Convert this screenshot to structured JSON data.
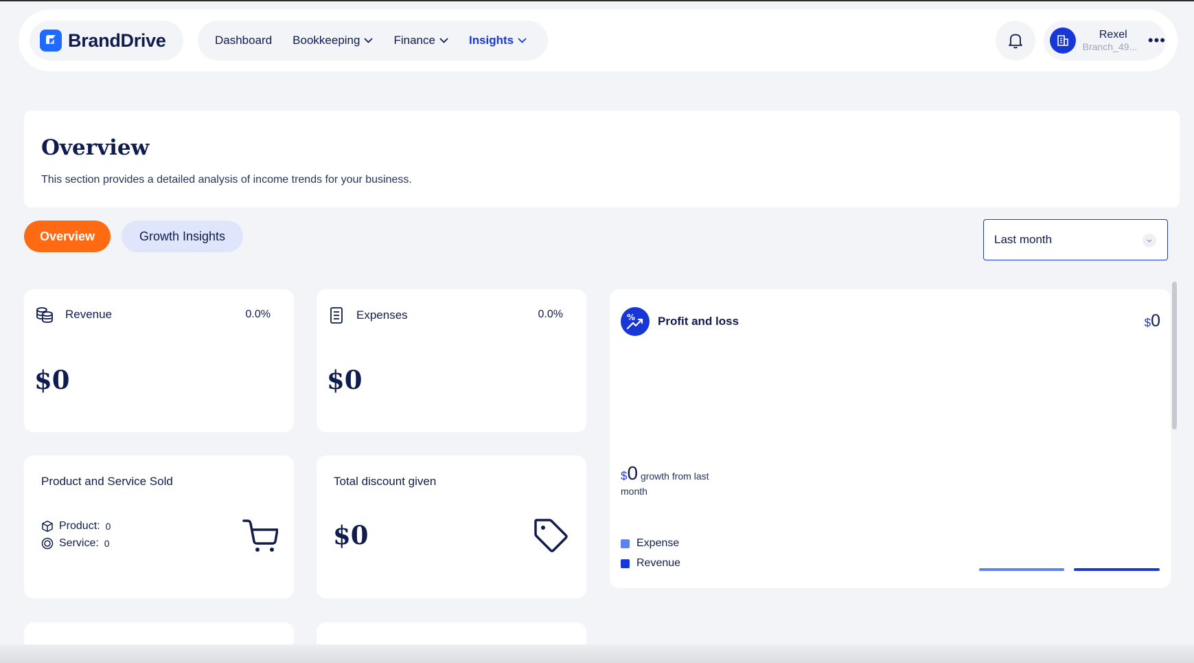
{
  "header": {
    "brand": "BrandDrive",
    "nav": [
      {
        "label": "Dashboard",
        "has_dropdown": false,
        "active": false
      },
      {
        "label": "Bookkeeping",
        "has_dropdown": true,
        "active": false
      },
      {
        "label": "Finance",
        "has_dropdown": true,
        "active": false
      },
      {
        "label": "Insights",
        "has_dropdown": true,
        "active": true
      }
    ],
    "user": {
      "name": "Rexel",
      "branch": "Branch_49..."
    },
    "icons": {
      "notifications": "bell-icon",
      "more": "more-horizontal-icon",
      "avatar": "building-icon"
    }
  },
  "overview": {
    "title": "Overview",
    "description": "This section provides a detailed analysis of income trends for your business."
  },
  "tabs": [
    {
      "label": "Overview",
      "active": true
    },
    {
      "label": "Growth Insights",
      "active": false
    }
  ],
  "period": {
    "selected": "Last month"
  },
  "cards": {
    "revenue": {
      "label": "Revenue",
      "change": "0.0%",
      "value": "$0"
    },
    "expenses": {
      "label": "Expenses",
      "change": "0.0%",
      "value": "$0"
    },
    "products": {
      "title": "Product and Service Sold",
      "product_label": "Product:",
      "product_count": "0",
      "service_label": "Service:",
      "service_count": "0"
    },
    "discount": {
      "title": "Total discount given",
      "value": "$0"
    }
  },
  "profit_loss": {
    "title": "Profit and loss",
    "currency": "$",
    "total": "0",
    "growth_value": "0",
    "growth_text": "growth from last month",
    "legend": [
      {
        "label": "Expense",
        "color": "#5b82f0"
      },
      {
        "label": "Revenue",
        "color": "#1738d6"
      }
    ]
  },
  "colors": {
    "accent": "#1738d6",
    "tab_active": "#ff6a13",
    "navy": "#0f1c4d"
  }
}
